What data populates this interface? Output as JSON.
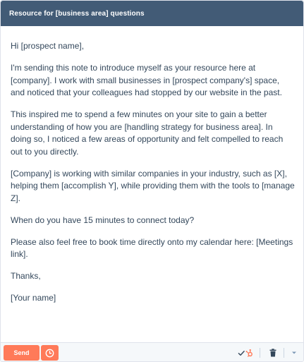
{
  "window": {
    "title": "Resource for [business area] questions"
  },
  "email": {
    "paragraphs": [
      "Hi [prospect name],",
      "I'm sending this note to introduce myself as your resource here at [company]. I work with small businesses in [prospect company's] space, and noticed that your colleagues had stopped by our website in the past.",
      "This inspired me to spend a few minutes on your site to gain a better understanding of how you are [handling strategy for business area]. In doing so, I noticed a few areas of opportunity and felt compelled to reach out to you directly.",
      "[Company] is working with similar companies in your industry, such as [X], helping them [accomplish Y], while providing them with the tools to [manage Z].",
      "When do you have 15 minutes to connect today?",
      "Please also feel free to book time directly onto my calendar here: [Meetings link].",
      "Thanks,",
      "[Your name]"
    ]
  },
  "footer": {
    "send_label": "Send",
    "icons": [
      "clock-icon",
      "checkmark-icon",
      "hubspot-sprocket-icon",
      "trash-icon",
      "caret-down-icon"
    ]
  },
  "colors": {
    "titlebar": "#425b76",
    "accent": "#ff7a59",
    "text": "#33475b",
    "footer_bg": "#f5f8fa"
  }
}
